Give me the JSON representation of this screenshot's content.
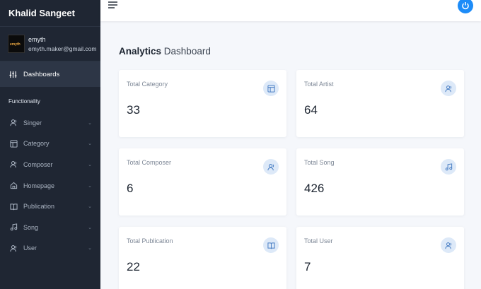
{
  "app": {
    "title": "Khalid Sangeet"
  },
  "user": {
    "name": "emyth",
    "email": "emyth.maker@gmail.com",
    "avatar_text": "emyth"
  },
  "sidebar": {
    "active_item": {
      "label": "Dashboards",
      "icon": "sliders-icon"
    },
    "section_title": "Functionality",
    "items": [
      {
        "label": "Singer",
        "icon": "users-icon"
      },
      {
        "label": "Category",
        "icon": "layout-icon"
      },
      {
        "label": "Composer",
        "icon": "users-icon"
      },
      {
        "label": "Homepage",
        "icon": "home-icon"
      },
      {
        "label": "Publication",
        "icon": "book-icon"
      },
      {
        "label": "Song",
        "icon": "music-icon"
      },
      {
        "label": "User",
        "icon": "users-icon"
      }
    ]
  },
  "header": {
    "menu_icon": "menu-icon",
    "power_icon": "power-icon"
  },
  "main": {
    "title_bold": "Analytics",
    "title_light": "Dashboard",
    "cards": [
      {
        "title": "Total Category",
        "value": "33",
        "icon": "layout-icon"
      },
      {
        "title": "Total Artist",
        "value": "64",
        "icon": "users-icon"
      },
      {
        "title": "Total Composer",
        "value": "6",
        "icon": "users-icon"
      },
      {
        "title": "Total Song",
        "value": "426",
        "icon": "music-icon"
      },
      {
        "title": "Total Publication",
        "value": "22",
        "icon": "book-icon"
      },
      {
        "title": "Total User",
        "value": "7",
        "icon": "users-icon"
      }
    ]
  },
  "colors": {
    "sidebar_bg": "#1f2633",
    "accent": "#1d8cf8",
    "page_bg": "#f5f7fb",
    "icon_bg": "#dde9f8"
  }
}
